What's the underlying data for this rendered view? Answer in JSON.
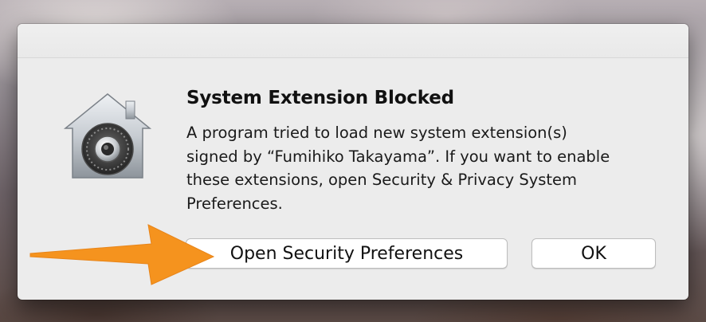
{
  "dialog": {
    "title": "System Extension Blocked",
    "message_lines": [
      "A program tried to load new system extension(s)",
      "signed by “Fumihiko Takayama”.  If you want to enable",
      "these extensions, open Security & Privacy System",
      "Preferences."
    ],
    "icon": "security-lock-house-icon",
    "buttons": {
      "open_security": "Open Security Preferences",
      "ok": "OK"
    }
  },
  "annotation": {
    "icon": "arrow-right-icon",
    "color": "#f5931e"
  },
  "colors": {
    "dialog_background": "#ececec",
    "button_background": "#ffffff"
  }
}
